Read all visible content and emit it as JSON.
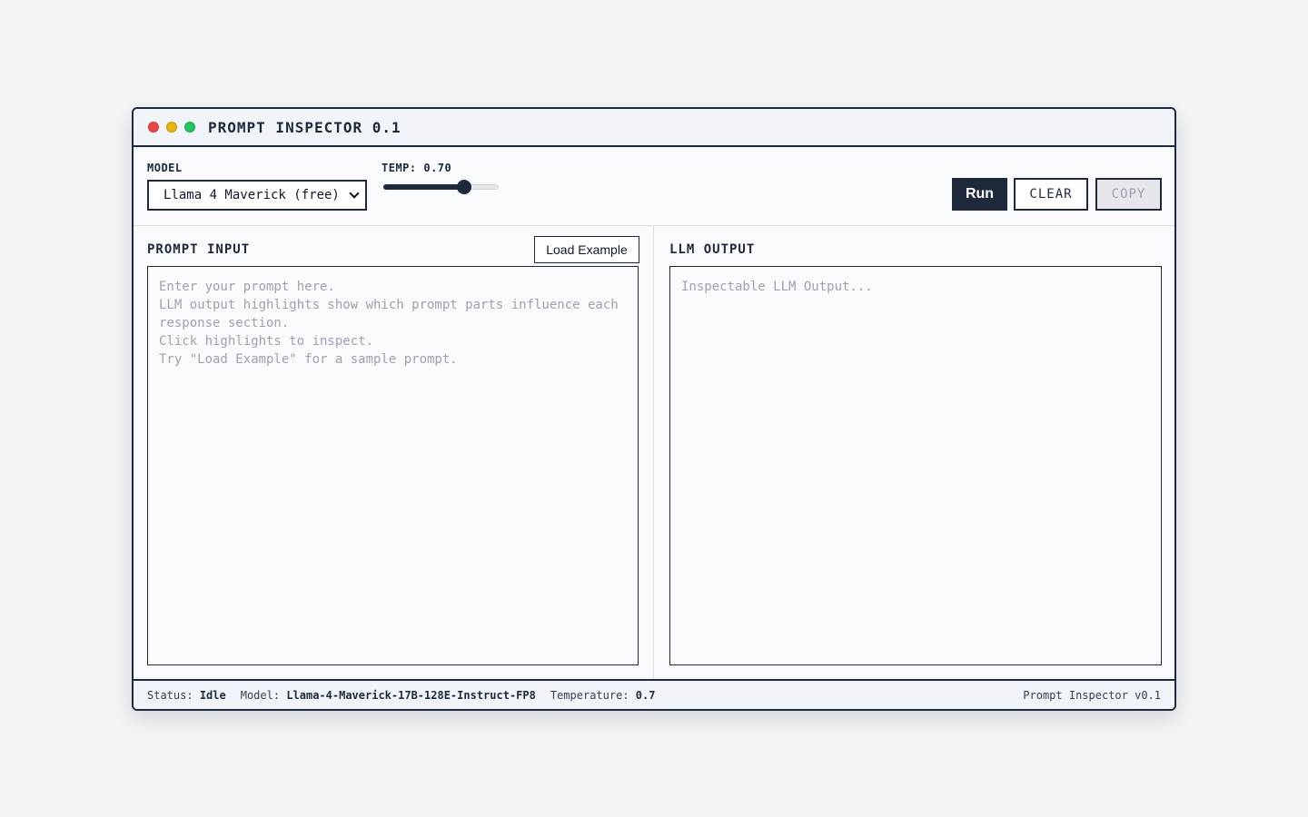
{
  "window": {
    "title": "PROMPT INSPECTOR 0.1"
  },
  "toolbar": {
    "model_label": "MODEL",
    "model_selected": "Llama 4 Maverick (free)",
    "temp_label": "TEMP: 0.70",
    "temp_fraction": 0.7,
    "run_label": "Run",
    "clear_label": "CLEAR",
    "copy_label": "COPY"
  },
  "prompt_panel": {
    "title": "PROMPT INPUT",
    "load_example_label": "Load Example",
    "placeholder_lines": [
      "Enter your prompt here.",
      "LLM output highlights show which prompt parts influence each response section.",
      "Click highlights to inspect.",
      "Try \"Load Example\" for a sample prompt."
    ]
  },
  "output_panel": {
    "title": "LLM OUTPUT",
    "placeholder": "Inspectable LLM Output..."
  },
  "status_bar": {
    "status_label": "Status:",
    "status_value": "Idle",
    "model_label": "Model:",
    "model_value": "Llama-4-Maverick-17B-128E-Instruct-FP8",
    "temperature_label": "Temperature:",
    "temperature_value": "0.7",
    "app_version": "Prompt Inspector v0.1"
  },
  "colors": {
    "background": "#f3f4f6",
    "primary": "#1e293b",
    "traffic_red": "#ef4444",
    "traffic_yellow": "#eab308",
    "traffic_green": "#22c55e",
    "placeholder_text": "#9ca3af"
  }
}
